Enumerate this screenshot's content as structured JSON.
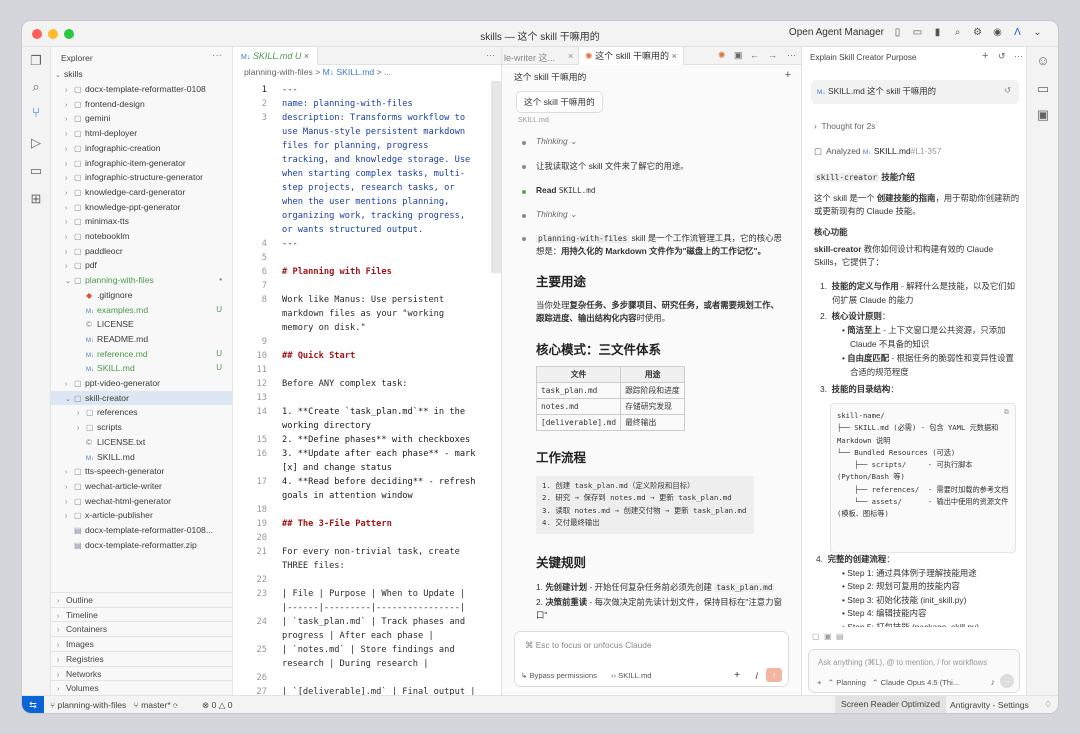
{
  "window": {
    "title": "skills — 这个 skill 干嘛用的",
    "agent_manager": "Open Agent Manager"
  },
  "explorer": {
    "title": "Explorer",
    "root": "skills",
    "items": [
      {
        "label": "docx-template-reformatter-0108",
        "kind": "folder",
        "depth": 1,
        "open": false
      },
      {
        "label": "frontend-design",
        "kind": "folder",
        "depth": 1,
        "open": false
      },
      {
        "label": "gemini",
        "kind": "folder",
        "depth": 1,
        "open": false
      },
      {
        "label": "html-deployer",
        "kind": "folder",
        "depth": 1,
        "open": false
      },
      {
        "label": "infographic-creation",
        "kind": "folder",
        "depth": 1,
        "open": false
      },
      {
        "label": "infographic-item-generator",
        "kind": "folder",
        "depth": 1,
        "open": false
      },
      {
        "label": "infographic-structure-generator",
        "kind": "folder",
        "depth": 1,
        "open": false
      },
      {
        "label": "knowledge-card-generator",
        "kind": "folder",
        "depth": 1,
        "open": false
      },
      {
        "label": "knowledge-ppt-generator",
        "kind": "folder",
        "depth": 1,
        "open": false
      },
      {
        "label": "minimax-tts",
        "kind": "folder",
        "depth": 1,
        "open": false
      },
      {
        "label": "notebooklm",
        "kind": "folder",
        "depth": 1,
        "open": false
      },
      {
        "label": "paddleocr",
        "kind": "folder",
        "depth": 1,
        "open": false
      },
      {
        "label": "pdf",
        "kind": "folder",
        "depth": 1,
        "open": false
      },
      {
        "label": "planning-with-files",
        "kind": "folder",
        "depth": 1,
        "open": true,
        "green": true,
        "badge": "•"
      },
      {
        "label": ".gitignore",
        "kind": "file",
        "depth": 2,
        "icon": "◆"
      },
      {
        "label": "examples.md",
        "kind": "file",
        "depth": 2,
        "icon": "M↓",
        "green": true,
        "badge": "U"
      },
      {
        "label": "LICENSE",
        "kind": "file",
        "depth": 2,
        "icon": "©"
      },
      {
        "label": "README.md",
        "kind": "file",
        "depth": 2,
        "icon": "M↓"
      },
      {
        "label": "reference.md",
        "kind": "file",
        "depth": 2,
        "icon": "M↓",
        "green": true,
        "badge": "U"
      },
      {
        "label": "SKILL.md",
        "kind": "file",
        "depth": 2,
        "icon": "M↓",
        "green": true,
        "badge": "U"
      },
      {
        "label": "ppt-video-generator",
        "kind": "folder",
        "depth": 1,
        "open": false
      },
      {
        "label": "skill-creator",
        "kind": "folder",
        "depth": 1,
        "open": true,
        "sel": true
      },
      {
        "label": "references",
        "kind": "folder",
        "depth": 2,
        "open": false
      },
      {
        "label": "scripts",
        "kind": "folder",
        "depth": 2,
        "open": false
      },
      {
        "label": "LICENSE.txt",
        "kind": "file",
        "depth": 2,
        "icon": "©"
      },
      {
        "label": "SKILL.md",
        "kind": "file",
        "depth": 2,
        "icon": "M↓"
      },
      {
        "label": "tts-speech-generator",
        "kind": "folder",
        "depth": 1,
        "open": false
      },
      {
        "label": "wechat-article-writer",
        "kind": "folder",
        "depth": 1,
        "open": false
      },
      {
        "label": "wechat-html-generator",
        "kind": "folder",
        "depth": 1,
        "open": false
      },
      {
        "label": "x-article-publisher",
        "kind": "folder",
        "depth": 1,
        "open": false
      },
      {
        "label": "docx-template-reformatter-0108...",
        "kind": "file",
        "depth": 1,
        "icon": "▤"
      },
      {
        "label": "docx-template-reformatter.zip",
        "kind": "file",
        "depth": 1,
        "icon": "▤"
      }
    ],
    "sections": [
      "Outline",
      "Timeline",
      "Containers",
      "Images",
      "Registries",
      "Networks",
      "Volumes",
      "Docker Contexts",
      "Help and Feedback"
    ]
  },
  "editor": {
    "tab": "SKILL.md",
    "tab_badge": "U",
    "tab_icon": "M↓",
    "breadcrumb": [
      "planning-with-files",
      ">",
      "M↓ SKILL.md",
      ">",
      "..."
    ],
    "lines": [
      {
        "n": "1",
        "t": "---"
      },
      {
        "n": "2",
        "t": "name: planning-with-files"
      },
      {
        "n": "3",
        "t": "description: Transforms workflow to\nuse Manus-style persistent markdown\nfiles for planning, progress\ntracking, and knowledge storage. Use\nwhen starting complex tasks, multi-\nstep projects, research tasks, or\nwhen the user mentions planning,\norganizing work, tracking progress,\nor wants structured output."
      },
      {
        "n": "4",
        "t": "---"
      },
      {
        "n": "5",
        "t": ""
      },
      {
        "n": "6",
        "t": "# Planning with Files"
      },
      {
        "n": "7",
        "t": ""
      },
      {
        "n": "8",
        "t": "Work like Manus: Use persistent\nmarkdown files as your \"working\nmemory on disk.\""
      },
      {
        "n": "9",
        "t": ""
      },
      {
        "n": "10",
        "t": "## Quick Start"
      },
      {
        "n": "11",
        "t": ""
      },
      {
        "n": "12",
        "t": "Before ANY complex task:"
      },
      {
        "n": "13",
        "t": ""
      },
      {
        "n": "14",
        "t": "1. **Create `task_plan.md`** in the\nworking directory"
      },
      {
        "n": "15",
        "t": "2. **Define phases** with checkboxes"
      },
      {
        "n": "16",
        "t": "3. **Update after each phase** - mark\n[x] and change status"
      },
      {
        "n": "17",
        "t": "4. **Read before deciding** - refresh\ngoals in attention window"
      },
      {
        "n": "18",
        "t": ""
      },
      {
        "n": "19",
        "t": "## The 3-File Pattern"
      },
      {
        "n": "20",
        "t": ""
      },
      {
        "n": "21",
        "t": "For every non-trivial task, create\nTHREE files:"
      },
      {
        "n": "22",
        "t": ""
      },
      {
        "n": "23",
        "t": "| File | Purpose | When to Update |\n|------|---------|----------------|"
      },
      {
        "n": "24",
        "t": "| `task_plan.md` | Track phases and\nprogress | After each phase |"
      },
      {
        "n": "25",
        "t": "| `notes.md` | Store findings and\nresearch | During research |"
      },
      {
        "n": "26",
        "t": ""
      },
      {
        "n": "27",
        "t": "| `[deliverable].md` | Final output |\nAt completion |"
      }
    ]
  },
  "chat": {
    "tab_prev": "le-writer 这...",
    "tab_active": "这个 skill 干嘛用的",
    "heading": "这个 skill 干嘛用的",
    "user_msg": "这个 skill 干嘛用的",
    "user_file": "SKILL.md",
    "thinking": "Thinking",
    "step1": "让我读取这个 skill 文件来了解它的用途。",
    "read_label": "Read",
    "read_file": "SKILL.md",
    "summary_code": "planning-with-files",
    "summary_text": " skill 是一个工作流管理工具，它的核心思想是：",
    "summary_bold": "用持久化的 Markdown 文件作为\"磁盘上的工作记忆\"。",
    "h_use": "主要用途",
    "use_text_a": "当你处理",
    "use_text_b": "复杂任务、多步骤项目、研究任务，或者需要规划工作、跟踪进度、输出结构化内容",
    "use_text_c": "时使用。",
    "h_mode": "核心模式：三文件体系",
    "table_head": [
      "文件",
      "用途"
    ],
    "table_rows": [
      [
        "task_plan.md",
        "跟踪阶段和进度"
      ],
      [
        "notes.md",
        "存储研究发现"
      ],
      [
        "[deliverable].md",
        "最终输出"
      ]
    ],
    "h_flow": "工作流程",
    "flow": [
      "1. 创建 task_plan.md（定义阶段和目标）",
      "2. 研究 → 保存到 notes.md → 更新 task_plan.md",
      "3. 读取 notes.md → 创建交付物 → 更新 task_plan.md",
      "4. 交付最终输出"
    ],
    "h_rules": "关键规则",
    "rule1_b": "先创建计划",
    "rule1": " - 开始任何复杂任务前必须先创建 ",
    "rule1_code": "task_plan.md",
    "rule2_b": "决策前重读",
    "rule2": " - 每次做决定前先读计划文件，保持目标在\"注意力窗口\"",
    "input_placeholder": "⌘ Esc to focus or unfocus Claude",
    "bypass": "Bypass permissions",
    "input_file": "SKILL.md",
    "slash": "/",
    "plus": "+"
  },
  "right": {
    "title": "Explain Skill Creator Purpose",
    "file_chip": "SKILL.md",
    "file_chip_text": "这个 skill 干嘛用的",
    "thought": "Thought for 2s",
    "analyzed": "Analyzed",
    "analyzed_file": "SKILL.md",
    "analyzed_range": "#L1-357",
    "intro_code": "skill-creator",
    "intro_h": " 技能介绍",
    "p1a": "这个 skill 是一个 ",
    "p1b": "创建技能的指南",
    "p1c": "，用于帮助你创建新的或更新现有的 Claude 技能。",
    "h_core": "核心功能",
    "p2a": "skill-creator",
    "p2b": " 教你如何设计和构建有效的 Claude Skills，它提供了：",
    "li1b": "技能的定义与作用",
    "li1": " - 解释什么是技能，以及它们如何扩展 Claude 的能力",
    "li2b": "核心设计原则",
    "li2": "：",
    "sub1b": "简洁至上",
    "sub1": " - 上下文窗口是公共资源，只添加 Claude 不具备的知识",
    "sub2b": "自由度匹配",
    "sub2": " - 根据任务的脆弱性和变异性设置合适的规范程度",
    "li3b": "技能的目录结构",
    "li3": "：",
    "tree": "skill-name/\n├── SKILL.md (必需) - 包含 YAML 元数据和\nMarkdown 说明\n└── Bundled Resources (可选)\n    ├── scripts/     - 可执行脚本\n(Python/Bash 等)\n    ├── references/  - 需要时加载的参考文档\n    └── assets/      - 输出中使用的资源文件\n(模板、图标等)",
    "li4b": "完整的创建流程",
    "li4": "：",
    "steps": [
      "Step 1: 通过具体例子理解技能用途",
      "Step 2: 规划可复用的技能内容",
      "Step 3: 初始化技能 (init_skill.py)",
      "Step 4: 编辑技能内容",
      "Step 5: 打包技能 (package_skill.py)"
    ],
    "input_placeholder": "Ask anything (⌘L), @ to mention, / for workflows",
    "planning": "Planning",
    "model": "Claude Opus 4.5 (Thi..."
  },
  "status": {
    "branch_repo": "planning-with-files",
    "branch": "master*",
    "errors": "0",
    "warnings": "0",
    "screen_reader": "Screen Reader Optimized",
    "settings": "Antigravity - Settings"
  },
  "colors": {
    "accent": "#0a64d6",
    "green": "#4a9a4a",
    "keyword_blue": "#1a3ea8",
    "heading_red": "#a31515"
  }
}
